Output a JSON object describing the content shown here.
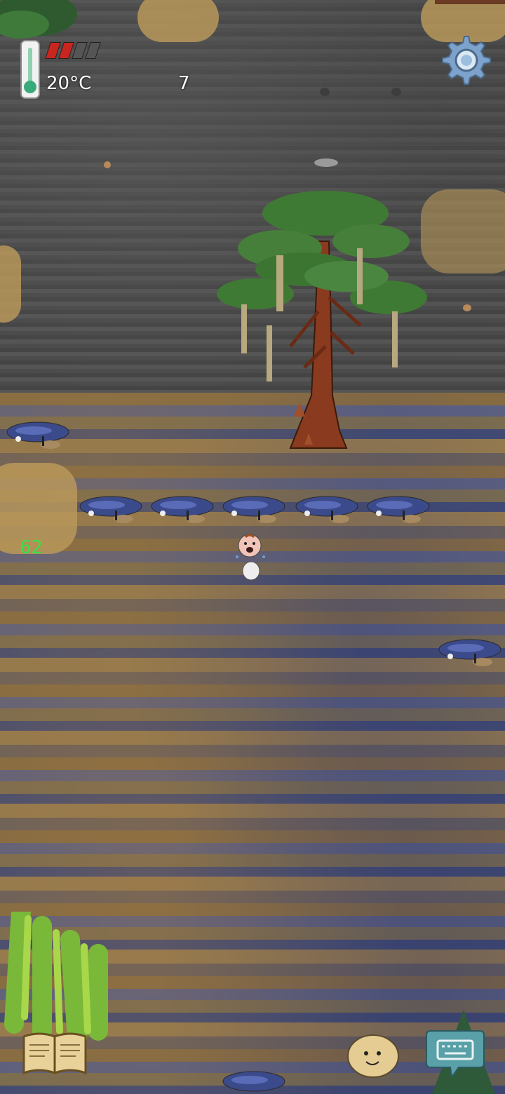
{
  "hud": {
    "temperature": "20°C",
    "counter": "7",
    "age": "62",
    "hunger_pips_filled": 2,
    "hunger_pips_total": 4
  },
  "colors": {
    "hunger_filled": "#c8261e",
    "hunger_empty": "#555555",
    "age_text": "#39e04a",
    "settings_gear": "#7da3cc",
    "keyboard_bubble": "#5aa0a8"
  },
  "icons": {
    "settings": "gear-icon",
    "recipe_book": "open-book-icon",
    "emote": "face-icon",
    "chat": "keyboard-icon",
    "temperature": "thermometer-icon"
  }
}
